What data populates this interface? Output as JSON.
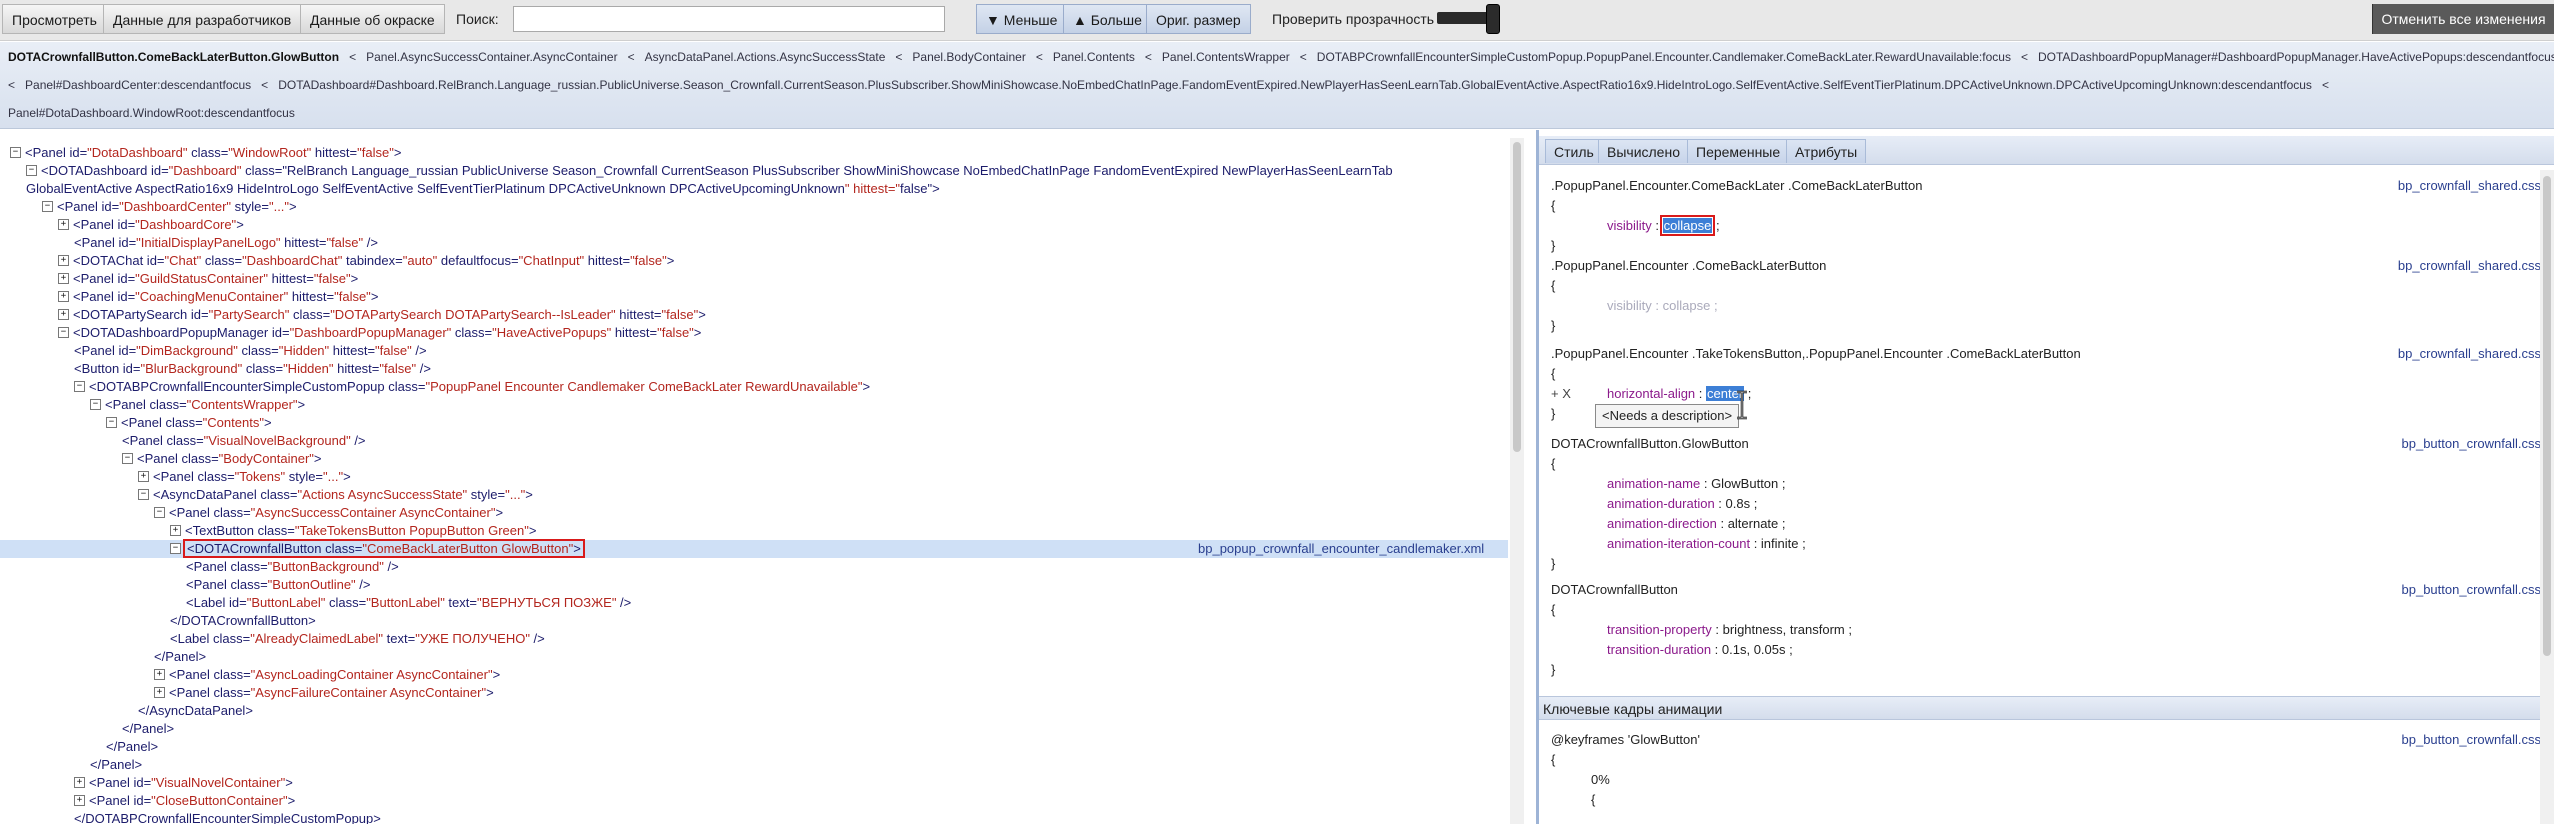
{
  "toolbar": {
    "view_label": "Просмотреть",
    "dev_data_label": "Данные для разработчиков",
    "paint_data_label": "Данные об окраске",
    "search_label": "Поиск:",
    "search_value": "",
    "less_label": "▼ Меньше",
    "more_label": "▲ Больше",
    "orig_size_label": "Ориг. размер",
    "transparency_label": "Проверить прозрачность",
    "reset_label": "Отменить все изменения"
  },
  "breadcrumb": {
    "line1": [
      "DOTACrownfallButton.ComeBackLaterButton.GlowButton",
      "<",
      "Panel.AsyncSuccessContainer.AsyncContainer",
      "<",
      "AsyncDataPanel.Actions.AsyncSuccessState",
      "<",
      "Panel.BodyContainer",
      "<",
      "Panel.Contents",
      "<",
      "Panel.ContentsWrapper",
      "<",
      "DOTABPCrownfallEncounterSimpleCustomPopup.PopupPanel.Encounter.Candlemaker.ComeBackLater.RewardUnavailable:focus",
      "<",
      "DOTADashboardPopupManager#DashboardPopupManager.HaveActivePopups:descendantfocus",
      "<"
    ],
    "line2": [
      "<",
      "Panel#DashboardCenter:descendantfocus",
      "<",
      "DOTADashboard#Dashboard.RelBranch.Language_russian.PublicUniverse.Season_Crownfall.CurrentSeason.PlusSubscriber.ShowMiniShowcase.NoEmbedChatInPage.FandomEventExpired.NewPlayerHasSeenLearnTab.GlobalEventActive.AspectRatio16x9.HideIntroLogo.SelfEventActive.SelfEventTierPlatinum.DPCActiveUnknown.DPCActiveUpcomingUnknown:descendantfocus",
      "<"
    ],
    "line3": [
      "Panel#DotaDashboard.WindowRoot:descendantfocus"
    ]
  },
  "tree": {
    "nodes": [
      {
        "toggle": "−",
        "text": "<Panel id=\"DotaDashboard\" class=\"WindowRoot\" hittest=\"false\">"
      },
      {
        "toggle": "−",
        "text": "<DOTADashboard id=\"Dashboard\" class=\"RelBranch Language_russian PublicUniverse Season_Crownfall CurrentSeason PlusSubscriber ShowMiniShowcase NoEmbedChatInPage FandomEventExpired NewPlayerHasSeenLearnTab"
      },
      {
        "toggle": "",
        "text": "GlobalEventActive AspectRatio16x9 HideIntroLogo SelfEventActive SelfEventTierPlatinum DPCActiveUnknown DPCActiveUpcomingUnknown\" hittest=\"false\">"
      },
      {
        "toggle": "−",
        "text": "<Panel id=\"DashboardCenter\" style=\"...\">"
      },
      {
        "toggle": "+",
        "text": "<Panel id=\"DashboardCore\">"
      },
      {
        "toggle": "",
        "text": "<Panel id=\"InitialDisplayPanelLogo\" hittest=\"false\" />"
      },
      {
        "toggle": "+",
        "text": "<DOTAChat id=\"Chat\" class=\"DashboardChat\" tabindex=\"auto\" defaultfocus=\"ChatInput\" hittest=\"false\">"
      },
      {
        "toggle": "+",
        "text": "<Panel id=\"GuildStatusContainer\" hittest=\"false\">"
      },
      {
        "toggle": "+",
        "text": "<Panel id=\"CoachingMenuContainer\" hittest=\"false\">"
      },
      {
        "toggle": "+",
        "text": "<DOTAPartySearch id=\"PartySearch\" class=\"DOTAPartySearch DOTAPartySearch--IsLeader\" hittest=\"false\">"
      },
      {
        "toggle": "−",
        "text": "<DOTADashboardPopupManager id=\"DashboardPopupManager\" class=\"HaveActivePopups\" hittest=\"false\">"
      },
      {
        "toggle": "",
        "text": "<Panel id=\"DimBackground\" class=\"Hidden\" hittest=\"false\" />"
      },
      {
        "toggle": "",
        "text": "<Button id=\"BlurBackground\" class=\"Hidden\" hittest=\"false\" />"
      },
      {
        "toggle": "−",
        "text": "<DOTABPCrownfallEncounterSimpleCustomPopup class=\"PopupPanel Encounter Candlemaker ComeBackLater RewardUnavailable\">"
      },
      {
        "toggle": "−",
        "text": "<Panel class=\"ContentsWrapper\">"
      },
      {
        "toggle": "−",
        "text": "<Panel class=\"Contents\">"
      },
      {
        "toggle": "",
        "text": "<Panel class=\"VisualNovelBackground\" />"
      },
      {
        "toggle": "−",
        "text": "<Panel class=\"BodyContainer\">"
      },
      {
        "toggle": "+",
        "text": "<Panel class=\"Tokens\" style=\"...\">"
      },
      {
        "toggle": "−",
        "text": "<AsyncDataPanel class=\"Actions AsyncSuccessState\" style=\"...\">"
      },
      {
        "toggle": "−",
        "text": "<Panel class=\"AsyncSuccessContainer AsyncContainer\">"
      },
      {
        "toggle": "+",
        "text": "<TextButton class=\"TakeTokensButton PopupButton Green\">"
      },
      {
        "toggle": "−",
        "text": "<DOTACrownfallButton class=\"ComeBackLaterButton GlowButton\">"
      },
      {
        "toggle": "",
        "text": "<Panel class=\"ButtonBackground\" />"
      },
      {
        "toggle": "",
        "text": "<Panel class=\"ButtonOutline\" />"
      },
      {
        "toggle": "",
        "text": "<Label id=\"ButtonLabel\" class=\"ButtonLabel\" text=\"ВЕРНУТЬСЯ ПОЗЖЕ\" />"
      },
      {
        "toggle": "",
        "text": "</DOTACrownfallButton>"
      },
      {
        "toggle": "",
        "text": "<Label class=\"AlreadyClaimedLabel\" text=\"УЖЕ ПОЛУЧЕНО\" />"
      },
      {
        "toggle": "",
        "text": "</Panel>"
      },
      {
        "toggle": "+",
        "text": "<Panel class=\"AsyncLoadingContainer AsyncContainer\">"
      },
      {
        "toggle": "+",
        "text": "<Panel class=\"AsyncFailureContainer AsyncContainer\">"
      },
      {
        "toggle": "",
        "text": "</AsyncDataPanel>"
      },
      {
        "toggle": "",
        "text": "</Panel>"
      },
      {
        "toggle": "",
        "text": "</Panel>"
      },
      {
        "toggle": "",
        "text": "</Panel>"
      },
      {
        "toggle": "+",
        "text": "<Panel id=\"VisualNovelContainer\">"
      },
      {
        "toggle": "+",
        "text": "<Panel id=\"CloseButtonContainer\">"
      },
      {
        "toggle": "",
        "text": "</DOTABPCrownfallEncounterSimpleCustomPopup>"
      }
    ],
    "selected_file": "bp_popup_crownfall_encounter_candlemaker.xml"
  },
  "styles_panel": {
    "tabs": [
      "Стиль",
      "Вычислено",
      "Переменные",
      "Атрибуты"
    ],
    "rules": [
      {
        "selector": ".PopupPanel.Encounter.ComeBackLater .ComeBackLaterButton",
        "source": "bp_crownfall_shared.css",
        "props": [
          {
            "name": "visibility",
            "value": "collapse"
          }
        ]
      },
      {
        "selector": ".PopupPanel.Encounter .ComeBackLaterButton",
        "source": "bp_crownfall_shared.css",
        "props": [
          {
            "name": "visibility",
            "value": "collapse"
          }
        ]
      },
      {
        "selector": ".PopupPanel.Encounter .TakeTokensButton,.PopupPanel.Encounter .ComeBackLaterButton",
        "source": "bp_crownfall_shared.css",
        "props": [
          {
            "name": "horizontal-align",
            "value": "center"
          }
        ]
      },
      {
        "selector": "DOTACrownfallButton.GlowButton",
        "source": "bp_button_crownfall.css",
        "props": [
          {
            "name": "animation-name",
            "value": "GlowButton"
          },
          {
            "name": "animation-duration",
            "value": "0.8s"
          },
          {
            "name": "animation-direction",
            "value": "alternate"
          },
          {
            "name": "animation-iteration-count",
            "value": "infinite"
          }
        ]
      },
      {
        "selector": "DOTACrownfallButton",
        "source": "bp_button_crownfall.css",
        "props": [
          {
            "name": "transition-property",
            "value": "brightness, transform"
          },
          {
            "name": "transition-duration",
            "value": "0.1s, 0.05s"
          }
        ]
      }
    ],
    "plus_x": "+ X",
    "tooltip": "<Needs a description>",
    "keyframes_title": "Ключевые кадры анимации",
    "keyframes": {
      "header": "@keyframes 'GlowButton'",
      "source": "bp_button_crownfall.css",
      "open_brace": "{",
      "percent": "0%",
      "inner_brace": "{"
    }
  },
  "colors": {
    "selection_outline": "#d91a1a",
    "selected_row": "#cfe0f6",
    "highlight": "#3d7fd6",
    "link": "#2a3f8f",
    "property_name": "#8b1a8b"
  }
}
